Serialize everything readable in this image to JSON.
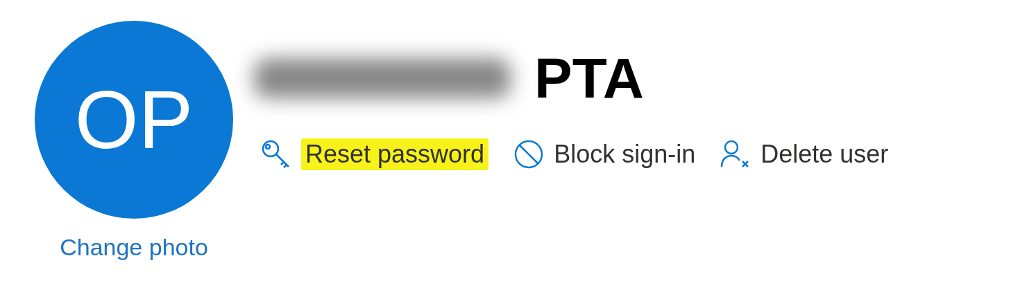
{
  "avatar": {
    "initials": "OP",
    "link": "Change photo"
  },
  "name": {
    "visible_part": "PTA",
    "redacted": true
  },
  "actions": [
    {
      "kind": "key",
      "label": "Reset password",
      "highlighted": true
    },
    {
      "kind": "block",
      "label": "Block sign-in",
      "highlighted": false
    },
    {
      "kind": "delete-user",
      "label": "Delete user",
      "highlighted": false
    }
  ]
}
